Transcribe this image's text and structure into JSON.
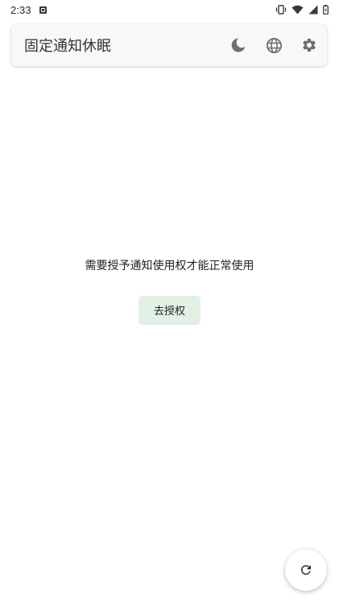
{
  "status_bar": {
    "time": "2:33",
    "app_icon": "accessibility-notification-icon",
    "icons": [
      "vibrate-icon",
      "wifi-icon",
      "signal-icon",
      "battery-icon"
    ]
  },
  "app_bar": {
    "title": "固定通知休眠",
    "actions": [
      {
        "name": "dark-mode-icon"
      },
      {
        "name": "language-globe-icon"
      },
      {
        "name": "settings-gear-icon"
      }
    ]
  },
  "main": {
    "message": "需要授予通知使用权才能正常使用",
    "authorize_label": "去授权"
  },
  "fab": {
    "icon": "refresh-icon"
  },
  "colors": {
    "background": "#ffffff",
    "app_bar_bg": "#f8f8f8",
    "icon_gray": "#6f6f6f",
    "button_bg": "#e1f1e4"
  }
}
